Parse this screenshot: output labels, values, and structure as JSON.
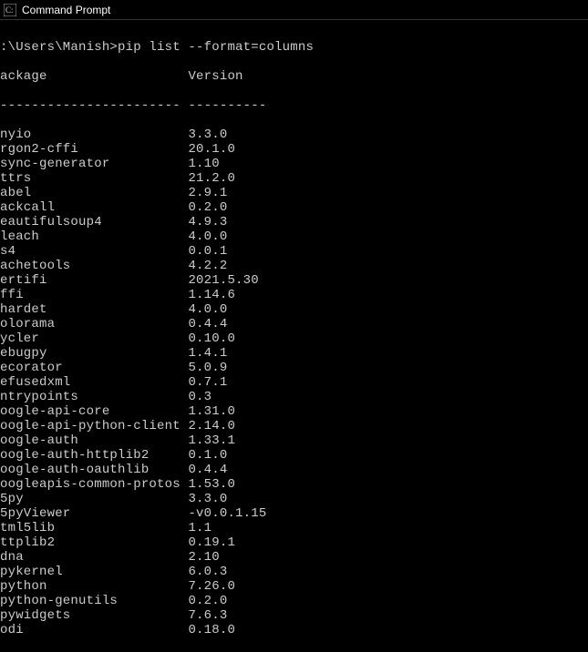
{
  "window": {
    "title": "Command Prompt"
  },
  "terminal": {
    "prompt": ":\\Users\\Manish>pip list --format=columns",
    "header_package": "ackage",
    "header_version": "Version",
    "divider_package": "-----------------------",
    "divider_version": "----------",
    "packages": [
      {
        "name": "nyio",
        "version": "3.3.0"
      },
      {
        "name": "rgon2-cffi",
        "version": "20.1.0"
      },
      {
        "name": "sync-generator",
        "version": "1.10"
      },
      {
        "name": "ttrs",
        "version": "21.2.0"
      },
      {
        "name": "abel",
        "version": "2.9.1"
      },
      {
        "name": "ackcall",
        "version": "0.2.0"
      },
      {
        "name": "eautifulsoup4",
        "version": "4.9.3"
      },
      {
        "name": "leach",
        "version": "4.0.0"
      },
      {
        "name": "s4",
        "version": "0.0.1"
      },
      {
        "name": "achetools",
        "version": "4.2.2"
      },
      {
        "name": "ertifi",
        "version": "2021.5.30"
      },
      {
        "name": "ffi",
        "version": "1.14.6"
      },
      {
        "name": "hardet",
        "version": "4.0.0"
      },
      {
        "name": "olorama",
        "version": "0.4.4"
      },
      {
        "name": "ycler",
        "version": "0.10.0"
      },
      {
        "name": "ebugpy",
        "version": "1.4.1"
      },
      {
        "name": "ecorator",
        "version": "5.0.9"
      },
      {
        "name": "efusedxml",
        "version": "0.7.1"
      },
      {
        "name": "ntrypoints",
        "version": "0.3"
      },
      {
        "name": "oogle-api-core",
        "version": "1.31.0"
      },
      {
        "name": "oogle-api-python-client",
        "version": "2.14.0"
      },
      {
        "name": "oogle-auth",
        "version": "1.33.1"
      },
      {
        "name": "oogle-auth-httplib2",
        "version": "0.1.0"
      },
      {
        "name": "oogle-auth-oauthlib",
        "version": "0.4.4"
      },
      {
        "name": "oogleapis-common-protos",
        "version": "1.53.0"
      },
      {
        "name": "5py",
        "version": "3.3.0"
      },
      {
        "name": "5pyViewer",
        "version": "-v0.0.1.15"
      },
      {
        "name": "tml5lib",
        "version": "1.1"
      },
      {
        "name": "ttplib2",
        "version": "0.19.1"
      },
      {
        "name": "dna",
        "version": "2.10"
      },
      {
        "name": "pykernel",
        "version": "6.0.3"
      },
      {
        "name": "python",
        "version": "7.26.0"
      },
      {
        "name": "python-genutils",
        "version": "0.2.0"
      },
      {
        "name": "pywidgets",
        "version": "7.6.3"
      },
      {
        "name": "odi",
        "version": "0.18.0"
      }
    ]
  },
  "layout": {
    "name_col_width": 24
  }
}
